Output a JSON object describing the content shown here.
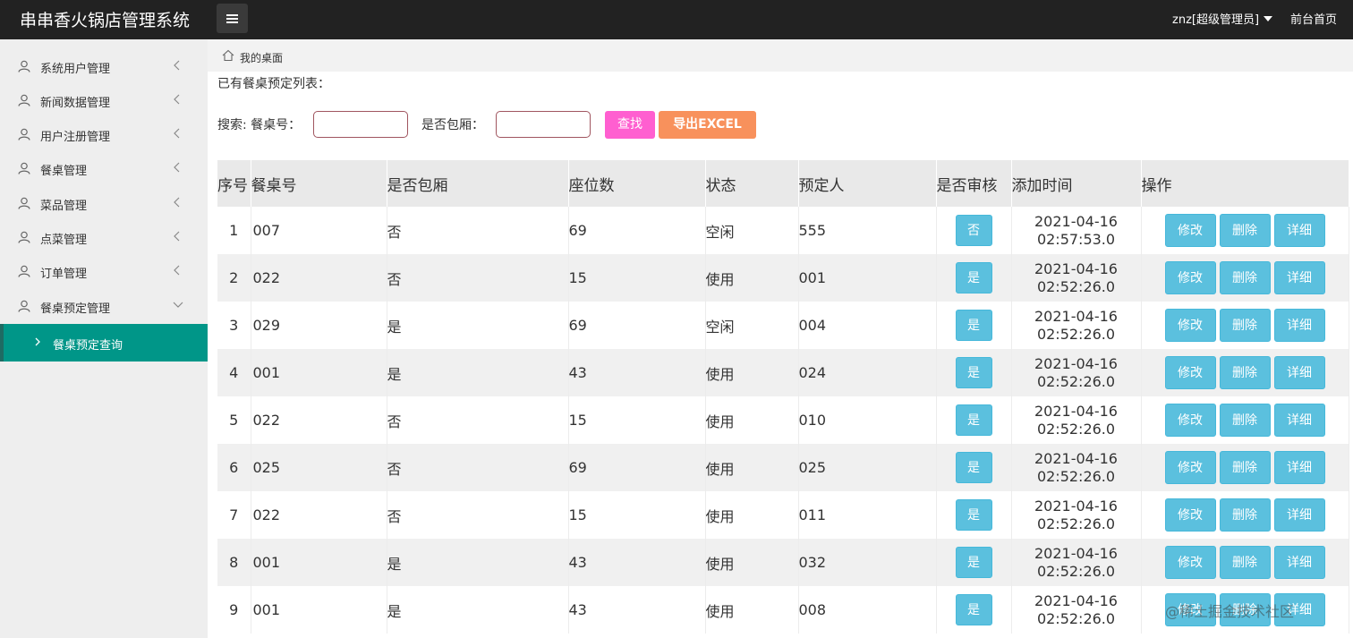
{
  "header": {
    "app_title": "串串香火锅店管理系统",
    "user": "znz[超级管理员]",
    "front_link": "前台首页"
  },
  "sidebar": {
    "items": [
      {
        "label": "系统用户管理"
      },
      {
        "label": "新闻数据管理"
      },
      {
        "label": "用户注册管理"
      },
      {
        "label": "餐桌管理"
      },
      {
        "label": "菜品管理"
      },
      {
        "label": "点菜管理"
      },
      {
        "label": "订单管理"
      },
      {
        "label": "餐桌预定管理"
      }
    ],
    "active_sub": "餐桌预定查询"
  },
  "breadcrumb": "我的桌面",
  "content": {
    "title": "已有餐桌预定列表：",
    "search_label": "搜索: 餐桌号：",
    "private_label": "是否包厢：",
    "search_button": "查找",
    "excel_button": "导出EXCEL"
  },
  "table": {
    "headers": [
      "序号",
      "餐桌号",
      "是否包厢",
      "座位数",
      "状态",
      "预定人",
      "是否审核",
      "添加时间",
      "操作"
    ],
    "op_labels": {
      "edit": "修改",
      "delete": "删除",
      "detail": "详细"
    },
    "rows": [
      {
        "no": "1",
        "table": "007",
        "private": "否",
        "seats": "69",
        "status": "空闲",
        "booker": "555",
        "audit": "否",
        "date": "2021-04-16",
        "time": "02:57:53.0"
      },
      {
        "no": "2",
        "table": "022",
        "private": "否",
        "seats": "15",
        "status": "使用",
        "booker": "001",
        "audit": "是",
        "date": "2021-04-16",
        "time": "02:52:26.0"
      },
      {
        "no": "3",
        "table": "029",
        "private": "是",
        "seats": "69",
        "status": "空闲",
        "booker": "004",
        "audit": "是",
        "date": "2021-04-16",
        "time": "02:52:26.0"
      },
      {
        "no": "4",
        "table": "001",
        "private": "是",
        "seats": "43",
        "status": "使用",
        "booker": "024",
        "audit": "是",
        "date": "2021-04-16",
        "time": "02:52:26.0"
      },
      {
        "no": "5",
        "table": "022",
        "private": "否",
        "seats": "15",
        "status": "使用",
        "booker": "010",
        "audit": "是",
        "date": "2021-04-16",
        "time": "02:52:26.0"
      },
      {
        "no": "6",
        "table": "025",
        "private": "否",
        "seats": "69",
        "status": "使用",
        "booker": "025",
        "audit": "是",
        "date": "2021-04-16",
        "time": "02:52:26.0"
      },
      {
        "no": "7",
        "table": "022",
        "private": "否",
        "seats": "15",
        "status": "使用",
        "booker": "011",
        "audit": "是",
        "date": "2021-04-16",
        "time": "02:52:26.0"
      },
      {
        "no": "8",
        "table": "001",
        "private": "是",
        "seats": "43",
        "status": "使用",
        "booker": "032",
        "audit": "是",
        "date": "2021-04-16",
        "time": "02:52:26.0"
      },
      {
        "no": "9",
        "table": "001",
        "private": "是",
        "seats": "43",
        "status": "使用",
        "booker": "008",
        "audit": "是",
        "date": "2021-04-16",
        "time": "02:52:26.0"
      }
    ]
  },
  "watermark": "@稀土掘金技术社区"
}
